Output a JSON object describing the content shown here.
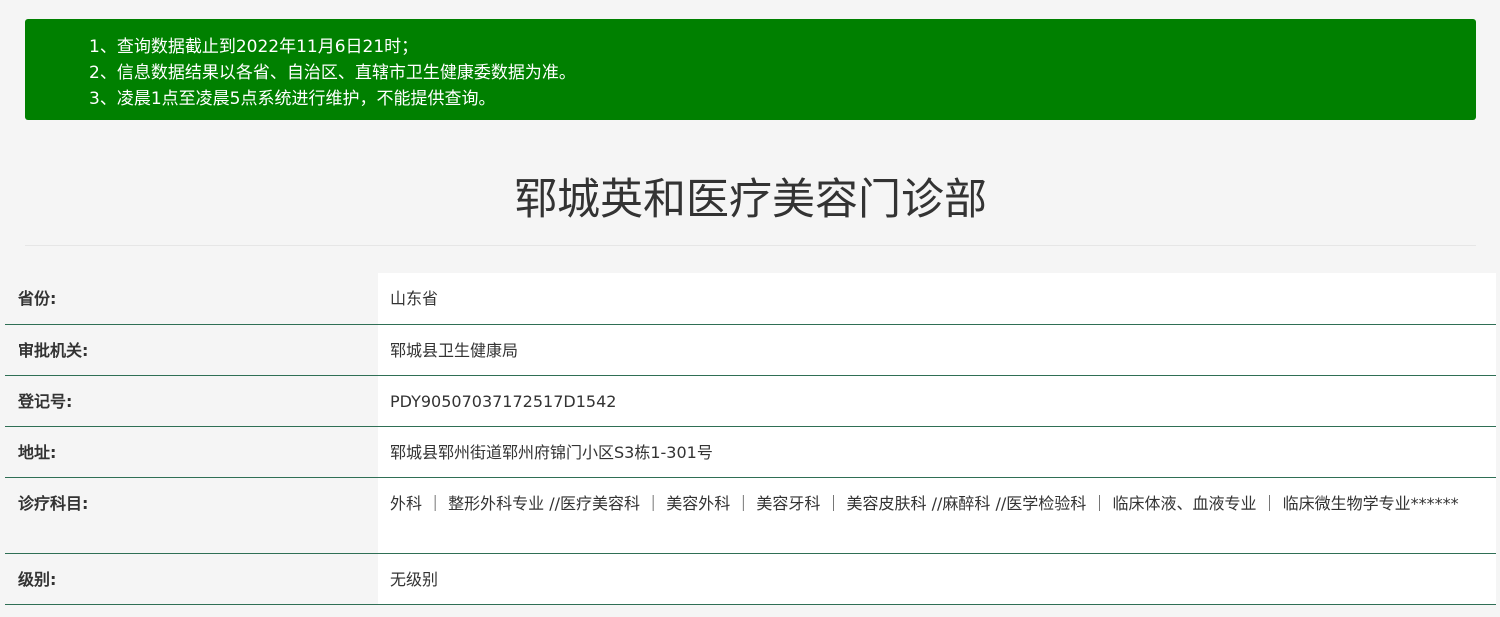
{
  "notice": {
    "items": [
      "1、查询数据截止到2022年11月6日21时；",
      "2、信息数据结果以各省、自治区、直辖市卫生健康委数据为准。",
      "3、凌晨1点至凌晨5点系统进行维护，不能提供查询。"
    ]
  },
  "page_title": "郓城英和医疗美容门诊部",
  "info": {
    "rows": [
      {
        "label": "省份:",
        "value": "山东省"
      },
      {
        "label": "审批机关:",
        "value": "郓城县卫生健康局"
      },
      {
        "label": "登记号:",
        "value": "PDY90507037172517D1542"
      },
      {
        "label": "地址:",
        "value": "郓城县郓州街道郓州府锦门小区S3栋1-301号"
      },
      {
        "label": "诊疗科目:",
        "value": "外科 ｜ 整形外科专业 //医疗美容科 ｜ 美容外科 ｜ 美容牙科 ｜ 美容皮肤科 //麻醉科 //医学检验科 ｜ 临床体液、血液专业 ｜ 临床微生物学专业******"
      },
      {
        "label": "级别:",
        "value": "无级别"
      }
    ]
  },
  "colors": {
    "notice_bg": "#008000",
    "row_border": "#2f6f55",
    "page_bg": "#f5f5f5"
  }
}
